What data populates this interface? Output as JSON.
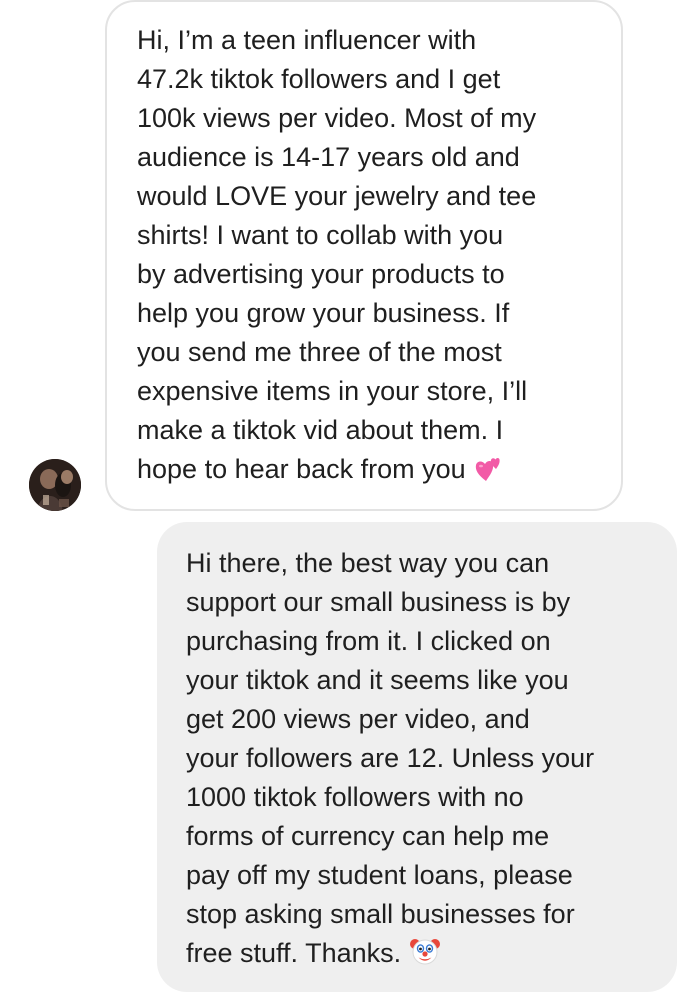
{
  "conversation": {
    "received": {
      "lines": [
        "Hi, I’m a teen influencer with",
        "47.2k tiktok followers and I get",
        "100k views per video. Most of my",
        "audience is 14-17 years old and",
        "would LOVE your jewelry and tee",
        "shirts! I want to collab with you",
        "by advertising your products to",
        "help you grow your business. If",
        "you send me three of the most",
        "expensive items in your store, I’ll",
        "make a tiktok vid about them. I",
        "hope to hear back from you"
      ],
      "trailing_emoji": "two-hearts-emoji"
    },
    "sent": {
      "lines": [
        "Hi there, the best way you can",
        "support our small business is by",
        "purchasing from it. I clicked on",
        "your tiktok and it seems like you",
        "get 200 views per video, and",
        "your followers are 12. Unless your",
        "1000 tiktok followers with no",
        "forms of currency can help me",
        "pay off my student loans, please",
        "stop asking small businesses for",
        "free stuff. Thanks."
      ],
      "trailing_emoji": "clown-face-emoji"
    }
  },
  "colors": {
    "received_bubble_bg": "#ffffff",
    "received_bubble_border": "#e3e3e3",
    "sent_bubble_bg": "#efefef",
    "text": "#1f1f1f",
    "heart_pink": "#f25aa6"
  }
}
